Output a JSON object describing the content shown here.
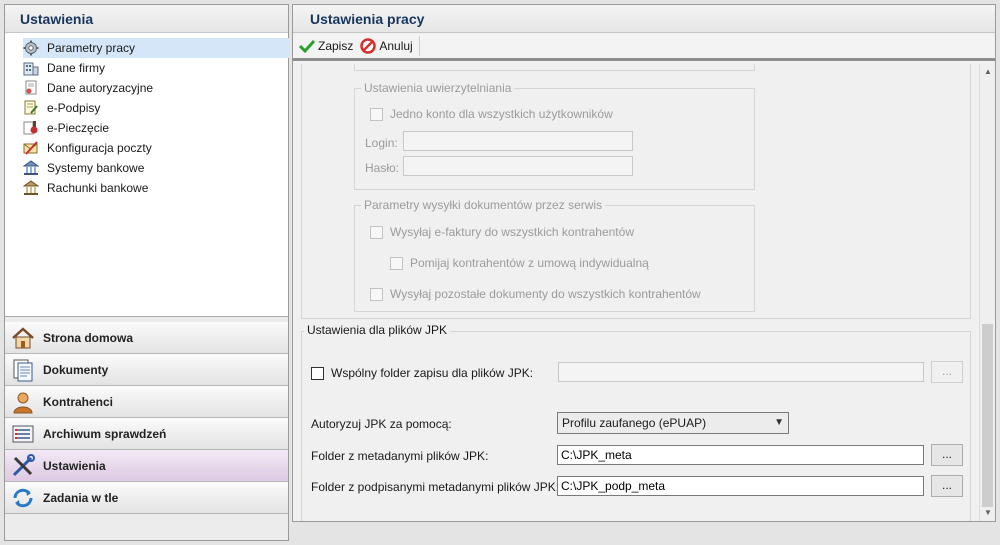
{
  "left": {
    "title": "Ustawienia",
    "tree": [
      {
        "label": "Parametry pracy",
        "icon": "gear-icon",
        "selected": true
      },
      {
        "label": "Dane firmy",
        "icon": "company-icon"
      },
      {
        "label": "Dane autoryzacyjne",
        "icon": "authorization-icon"
      },
      {
        "label": "e-Podpisy",
        "icon": "e-signature-icon"
      },
      {
        "label": "e-Pieczęcie",
        "icon": "e-seal-icon"
      },
      {
        "label": "Konfiguracja poczty",
        "icon": "mail-config-icon"
      },
      {
        "label": "Systemy bankowe",
        "icon": "bank-systems-icon"
      },
      {
        "label": "Rachunki bankowe",
        "icon": "bank-accounts-icon"
      }
    ],
    "nav": [
      {
        "label": "Strona domowa",
        "icon": "home-icon"
      },
      {
        "label": "Dokumenty",
        "icon": "documents-icon"
      },
      {
        "label": "Kontrahenci",
        "icon": "contractors-icon"
      },
      {
        "label": "Archiwum sprawdzeń",
        "icon": "archive-icon"
      },
      {
        "label": "Ustawienia",
        "icon": "settings-tools-icon",
        "active": true
      },
      {
        "label": "Zadania w tle",
        "icon": "background-tasks-icon"
      }
    ]
  },
  "right": {
    "title": "Ustawienia pracy",
    "toolbar": {
      "save": "Zapisz",
      "cancel": "Anuluj"
    },
    "auth_group": {
      "title": "Ustawienia uwierzytelniania",
      "single_account": "Jedno konto dla wszystkich użytkowników",
      "login_label": "Login:",
      "password_label": "Hasło:"
    },
    "send_group": {
      "title": "Parametry wysyłki dokumentów przez serwis",
      "send_einvoices": "Wysyłaj e-faktury do wszystkich kontrahentów",
      "skip_individual": "Pomijaj kontrahentów z umową indywidualną",
      "send_other": "Wysyłaj pozostałe dokumenty do wszystkich kontrahentów"
    },
    "jpk_group": {
      "title": "Ustawienia dla plików JPK",
      "common_folder": "Wspólny folder zapisu dla plików JPK:",
      "common_folder_value": "",
      "authorize_label": "Autoryzuj JPK za pomocą:",
      "authorize_value": "Profilu zaufanego (ePUAP)",
      "meta_label": "Folder z metadanymi plików JPK:",
      "meta_value": "C:\\JPK_meta",
      "signed_meta_label": "Folder z podpisanymi metadanymi plików JPK:",
      "signed_meta_value": "C:\\JPK_podp_meta",
      "browse": "..."
    }
  }
}
